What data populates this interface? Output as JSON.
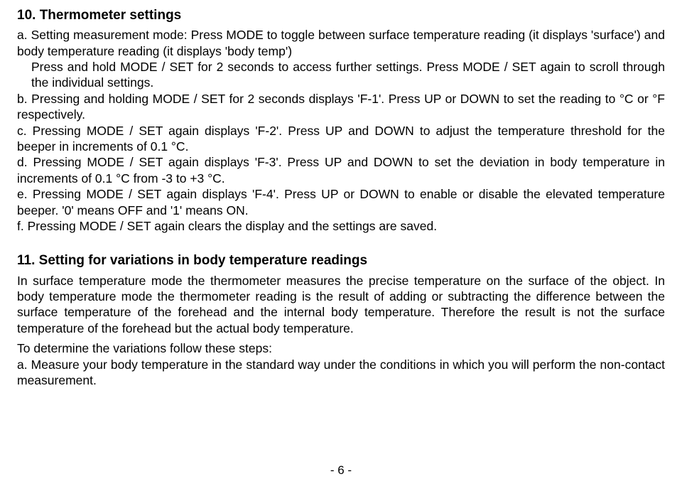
{
  "section10": {
    "heading": "10. Thermometer settings",
    "item_a": "a. Setting measurement mode: Press MODE to toggle between surface temperature reading (it displays 'surface') and body temperature reading (it displays 'body temp')",
    "item_a_cont1": "Press and hold MODE / SET for 2 seconds to access further settings. Press MODE / SET again to scroll through the individual settings.",
    "item_b": "b. Pressing and holding MODE / SET for 2 seconds displays 'F-1'. Press UP or DOWN to set the reading to °C or °F respectively.",
    "item_c": "c. Pressing MODE / SET again displays 'F-2'. Press UP and DOWN to adjust the temperature threshold for the beeper in increments of 0.1 °C.",
    "item_d": "d. Pressing MODE / SET again displays 'F-3'. Press UP and DOWN to set the deviation in body temperature in increments of 0.1 °C from -3 to +3 °C.",
    "item_e": "e. Pressing MODE / SET again displays 'F-4'. Press UP or DOWN to enable or disable the elevated temperature beeper. '0' means OFF and '1' means ON.",
    "item_f": "f. Pressing MODE / SET again clears the display and the settings are saved."
  },
  "section11": {
    "heading": "11. Setting for variations in body temperature readings",
    "para1": "In surface temperature mode the thermometer measures the precise temperature on the surface of the object. In body temperature mode the thermometer reading is the result of adding or subtracting the difference between the surface temperature of the forehead and the internal body temperature. Therefore the result is not the surface temperature of the forehead but the actual body temperature.",
    "para2": "To determine the variations follow these steps:",
    "item_a": "a. Measure your body temperature in the standard way under the conditions in which you will perform the non-contact measurement."
  },
  "page_number": "- 6 -"
}
